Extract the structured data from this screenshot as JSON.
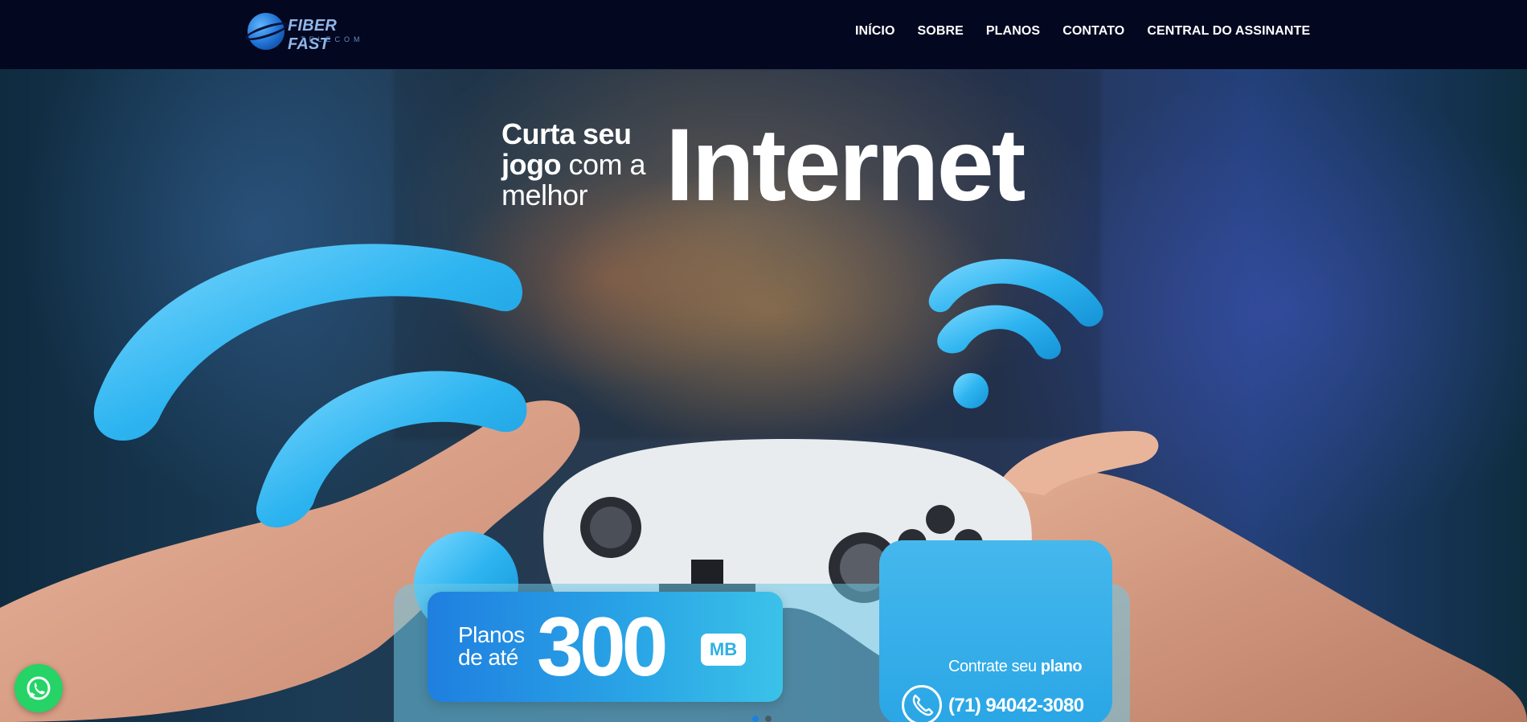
{
  "brand": {
    "name": "FIBER FAST",
    "tagline": "TELECOM",
    "colors": {
      "accent": "#2aa6e6",
      "navbar_bg": "#030720",
      "whatsapp": "#25d366"
    }
  },
  "nav": {
    "items": [
      {
        "label": "INÍCIO"
      },
      {
        "label": "SOBRE"
      },
      {
        "label": "PLANOS"
      },
      {
        "label": "CONTATO"
      },
      {
        "label": "CENTRAL DO ASSINANTE"
      }
    ]
  },
  "hero": {
    "headline_line1": "Curta seu",
    "headline_line2_bold": "jogo",
    "headline_line2_thin": "com a",
    "headline_line3": "melhor",
    "headline_big": "Internet",
    "plan_prefix_line1": "Planos",
    "plan_prefix_line2": "de até",
    "plan_speed": "300",
    "plan_unit": "MB",
    "contact_title_thin": "Contrate seu",
    "contact_title_bold": "plano",
    "contact_phone": "(71) 94042-3080",
    "contact_icon": "phone-icon",
    "slider_dots": 2,
    "slider_active": 1
  },
  "floating": {
    "whatsapp_icon": "whatsapp-icon"
  }
}
